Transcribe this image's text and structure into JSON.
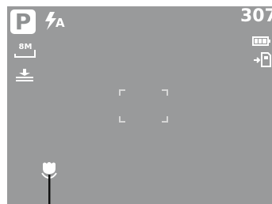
{
  "camera_display": {
    "shooting_mode": "P",
    "flash_mode": "A",
    "shots_remaining": "307",
    "resolution": "8M",
    "icons": {
      "flash": "flash-auto-icon",
      "battery": "battery-full-icon",
      "storage": "memory-card-icon",
      "quality": "image-quality-icon",
      "focus": "focus-frame-icon",
      "macro": "macro-flower-icon"
    },
    "colors": {
      "lcd_background": "#999a9b",
      "foreground": "#ffffff"
    }
  }
}
